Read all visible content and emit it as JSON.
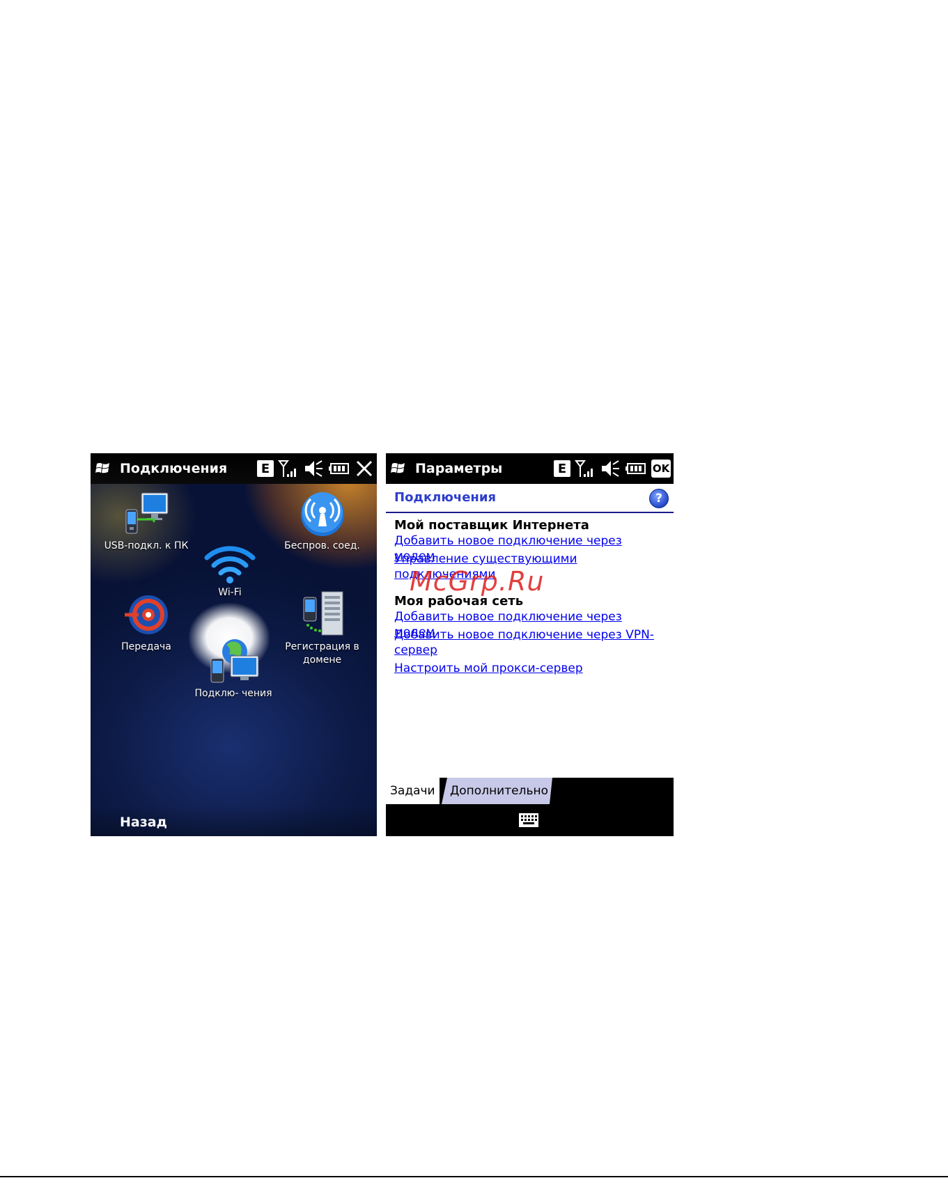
{
  "left_screen": {
    "title": "Подключения",
    "status_indicator": "E",
    "close_icon": "close-icon",
    "tiles": [
      {
        "label": "USB-подкл. к ПК",
        "icon": "usb-pc-icon"
      },
      {
        "label": "Беспров. соед.",
        "icon": "wireless-icon"
      },
      {
        "label": "Wi-Fi",
        "icon": "wifi-icon"
      },
      {
        "label": "Передача",
        "icon": "beam-icon"
      },
      {
        "label": "Регистрация в домене",
        "icon": "domain-server-icon"
      },
      {
        "label": "Подклю- чения",
        "icon": "connections-icon"
      }
    ],
    "softkey": "Назад"
  },
  "right_screen": {
    "title": "Параметры",
    "status_indicator": "E",
    "ok_label": "OK",
    "header": "Подключения",
    "help_label": "?",
    "sections": [
      {
        "title": "Мой поставщик Интернета",
        "links": [
          "Добавить новое подключение через модем",
          "Управление существующими подключениями"
        ]
      },
      {
        "title": "Моя рабочая сеть",
        "links": [
          "Добавить новое подключение через модем",
          "Добавить новое подключение через VPN-сервер",
          "Настроить мой прокси-сервер"
        ]
      }
    ],
    "watermark": "McGrp.Ru",
    "tabs": [
      "Задачи",
      "Дополнительно"
    ]
  },
  "colors": {
    "link": "#0000ee",
    "header_title": "#2e3ecb",
    "left_bg": "#0d1b4a"
  }
}
